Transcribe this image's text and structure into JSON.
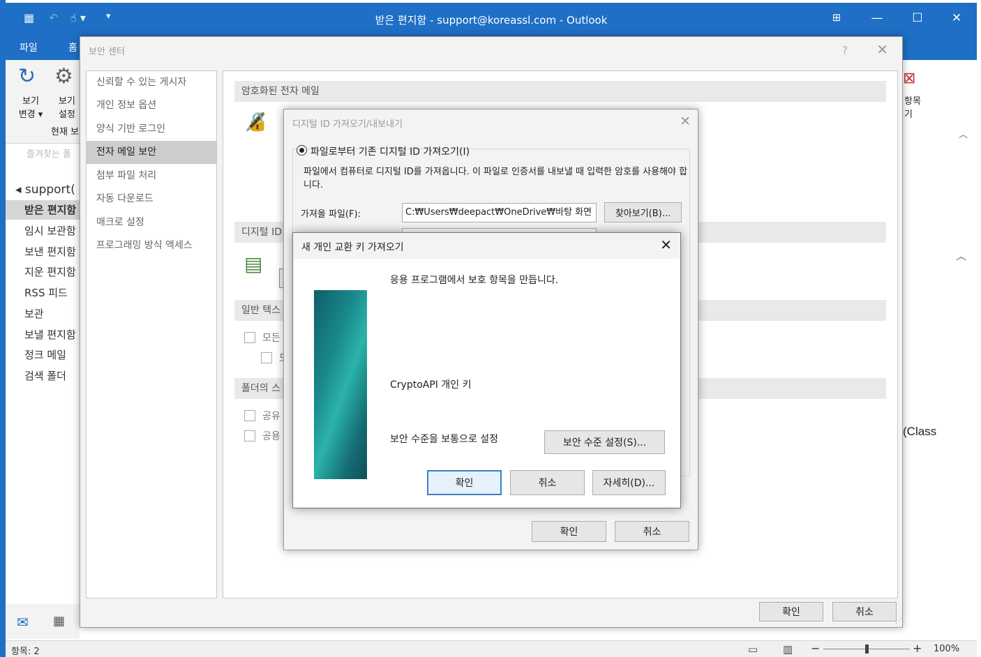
{
  "window": {
    "title": "받은 편지함 - support@koreassl.com  -  Outlook",
    "colors": {
      "accent": "#1e6fc5",
      "ribbon": "#f3f3f3",
      "selected": "#cdcdcd"
    }
  },
  "ribbon": {
    "tabs": [
      "파일",
      "홈"
    ],
    "buttons": [
      {
        "label": "보기\n변경 ▾",
        "icon": "change-view-icon"
      },
      {
        "label": "보기\n설정",
        "icon": "view-settings-icon"
      }
    ],
    "group_label": "현재 보",
    "right_button": "항목\n기"
  },
  "folder_pane": {
    "favorites_hint": "즐겨찾는 폴",
    "account": "◂ support(",
    "folders": [
      "받은 편지함",
      "임시 보관함",
      "보낸 편지함",
      "지운 편지함",
      "RSS 피드",
      "보관",
      "보낼 편지함",
      "정크 메일",
      "검색 폴더"
    ]
  },
  "reading_pane": {
    "partial_text": "(Class"
  },
  "status": {
    "items_label": "항목: 2",
    "zoom": "100%",
    "zoom_fraction": 0.5
  },
  "trust_center": {
    "title": "보안 센터",
    "help": "?",
    "nav": [
      "신뢰할 수 있는 게시자",
      "개인 정보 옵션",
      "양식 기반 로그인",
      "전자 메일 보안",
      "첨부 파일 처리",
      "자동 다운로드",
      "매크로 설정",
      "프로그래밍 방식 액세스"
    ],
    "selected_nav": "전자 메일 보안",
    "sections": [
      "암호화된 전자 메일",
      "디지털 ID",
      "일반 텍스",
      "폴더의 스"
    ],
    "checkboxes": [
      "모든",
      "도",
      "공유",
      "공용"
    ],
    "ok": "확인",
    "cancel": "취소"
  },
  "digital_id_dialog": {
    "title": "디지털 ID 가져오기/내보내기",
    "option_import": "파일로부터 기존 디지털 ID 가져오기(I)",
    "description": "파일에서 컴퓨터로 디지털 ID를 가져옵니다. 이 파일로 인증서를 내보낼 때 입력한 암호를 사용해야 합니다.",
    "file_label": "가져올 파일(F):",
    "file_value": "C:₩Users₩deepact₩OneDrive₩바탕 화면",
    "browse": "찾아보기(B)...",
    "ok": "확인",
    "cancel": "취소"
  },
  "new_key_dialog": {
    "title": "새 개인 교환 키 가져오기",
    "message": "응용 프로그램에서 보호 항목을 만듭니다.",
    "key_label": "CryptoAPI 개인 키",
    "security_level": "보안 수준을 보통으로 설정",
    "set_level_button": "보안 수준 설정(S)...",
    "ok": "확인",
    "cancel": "취소",
    "details": "자세히(D)..."
  }
}
